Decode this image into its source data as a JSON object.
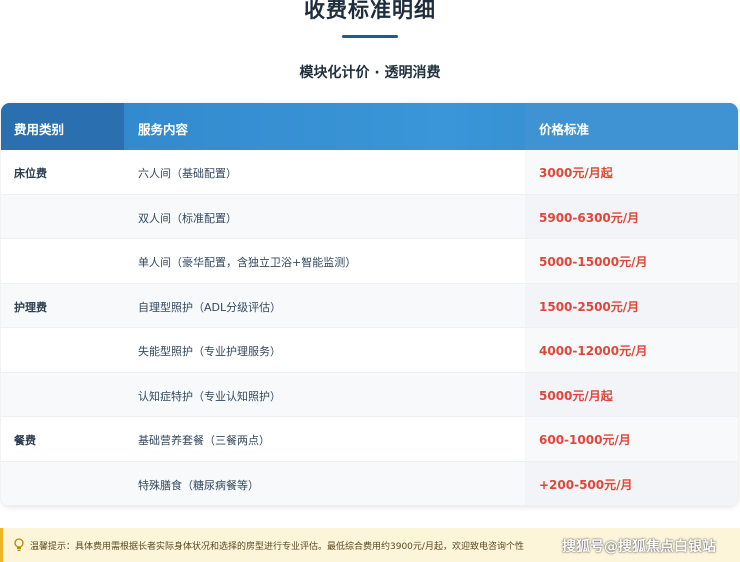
{
  "title": "收费标准明细",
  "subtitle": "模块化计价 · 透明消费",
  "table": {
    "headers": [
      "费用类别",
      "服务内容",
      "价格标准"
    ],
    "rows": [
      {
        "category": "床位费",
        "service": "六人间（基础配置）",
        "price": "3000元/月起"
      },
      {
        "category": "",
        "service": "双人间（标准配置）",
        "price": "5900-6300元/月"
      },
      {
        "category": "",
        "service": "单人间（豪华配置，含独立卫浴+智能监测）",
        "price": "5000-15000元/月"
      },
      {
        "category": "护理费",
        "service": "自理型照护（ADL分级评估）",
        "price": "1500-2500元/月"
      },
      {
        "category": "",
        "service": "失能型照护（专业护理服务）",
        "price": "4000-12000元/月"
      },
      {
        "category": "",
        "service": "认知症特护（专业认知照护）",
        "price": "5000元/月起"
      },
      {
        "category": "餐费",
        "service": "基础营养套餐（三餐两点）",
        "price": "600-1000元/月"
      },
      {
        "category": "",
        "service": "特殊膳食（糖尿病餐等）",
        "price": "+200-500元/月"
      }
    ]
  },
  "tip": {
    "icon": "lightbulb-icon",
    "text": "温馨提示：具体费用需根据长者实际身体状况和选择的房型进行专业评估。最低综合费用约3900元/月起，欢迎致电咨询个性"
  },
  "watermark": "搜狐号@搜狐焦点白银站",
  "colors": {
    "header_bg": "#3a96d8",
    "header_dark": "#2a6fb0",
    "price_red": "#e0463a",
    "tip_bg": "#fdf5d9",
    "accent_line": "#1c5c95"
  }
}
